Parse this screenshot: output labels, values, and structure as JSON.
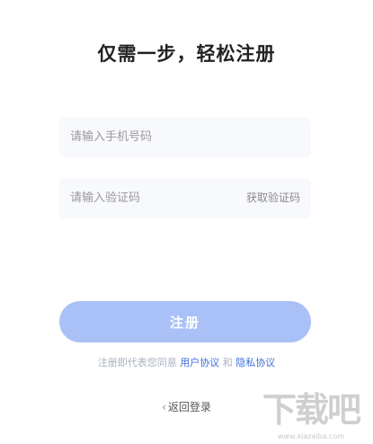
{
  "page": {
    "title": "仅需一步，轻松注册"
  },
  "form": {
    "phone_placeholder": "请输入手机号码",
    "code_placeholder": "请输入验证码",
    "get_code_label": "获取验证码",
    "submit_label": "注册"
  },
  "agreement": {
    "prefix": "注册即代表您同意",
    "user_agreement": "用户协议",
    "and": "和",
    "privacy_agreement": "隐私协议"
  },
  "back": {
    "chevron": "‹",
    "label": "返回登录"
  },
  "watermark": {
    "brand": "下载吧",
    "url": "www.xiazaiba.com"
  },
  "colors": {
    "primary_button": "#a9c1f6",
    "link": "#3f6ed8",
    "field_bg": "#f8f9fc"
  }
}
